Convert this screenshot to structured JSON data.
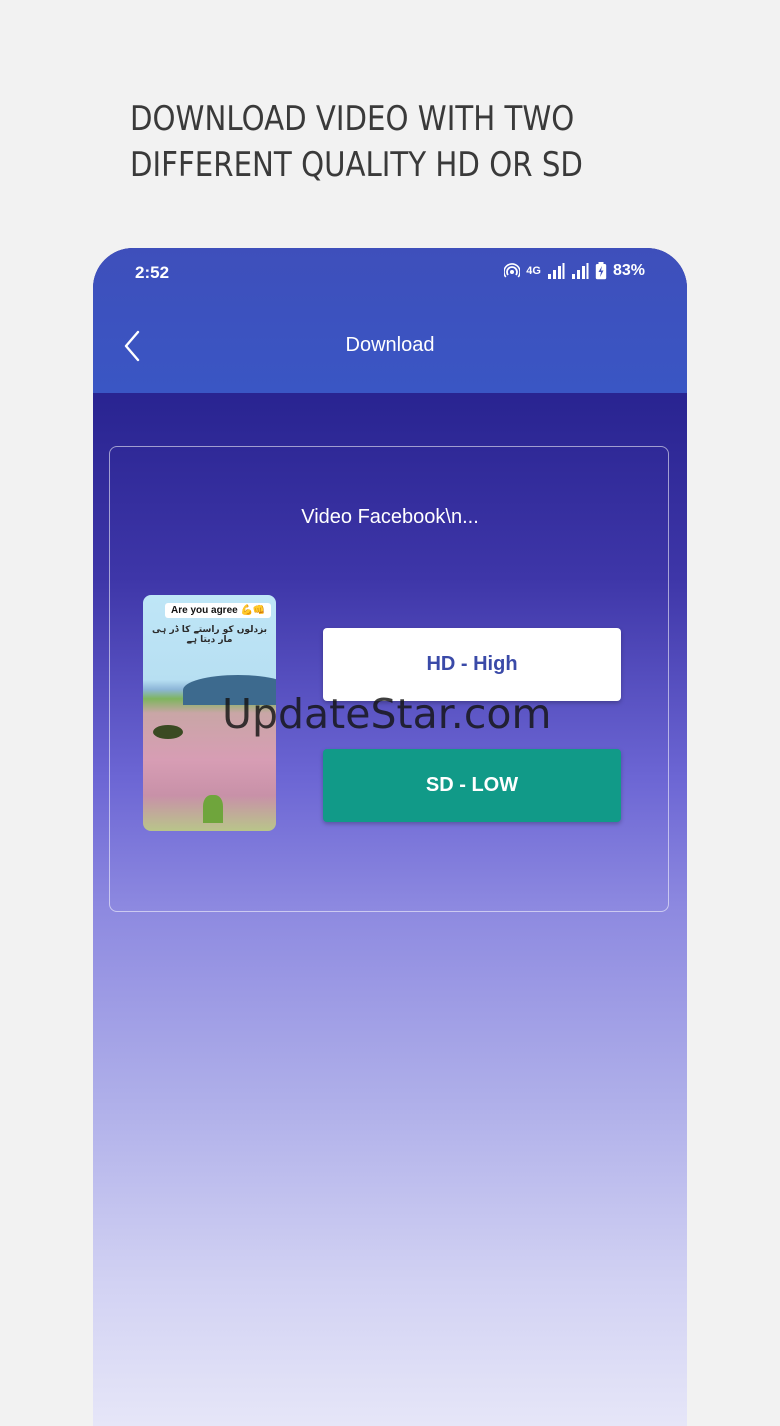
{
  "promo": {
    "line1": "DOWNLOAD VIDEO WITH TWO",
    "line2": "DIFFERENT QUALITY HD OR SD"
  },
  "status_bar": {
    "time": "2:52",
    "network": "4G",
    "battery": "83%",
    "icons": [
      "hotspot-icon",
      "signal-icon",
      "signal-icon",
      "battery-charging-icon"
    ]
  },
  "appbar": {
    "title": "Download",
    "back_icon": "chevron-left-icon"
  },
  "card": {
    "video_title": "Video Facebook\\n...",
    "thumbnail": {
      "caption": "Are you agree 💪👊",
      "subtitle": "بزدلوں کو راستے کا ڈر ہی مار دیتا ہے"
    },
    "hd_button_label": "HD - High",
    "sd_button_label": "SD - LOW"
  },
  "watermark": "UpdateStar.com",
  "colors": {
    "appbar": "#3a56c4",
    "hd_text": "#3a4aa8",
    "sd_button": "#119a88",
    "page_background": "#f2f2f2"
  }
}
